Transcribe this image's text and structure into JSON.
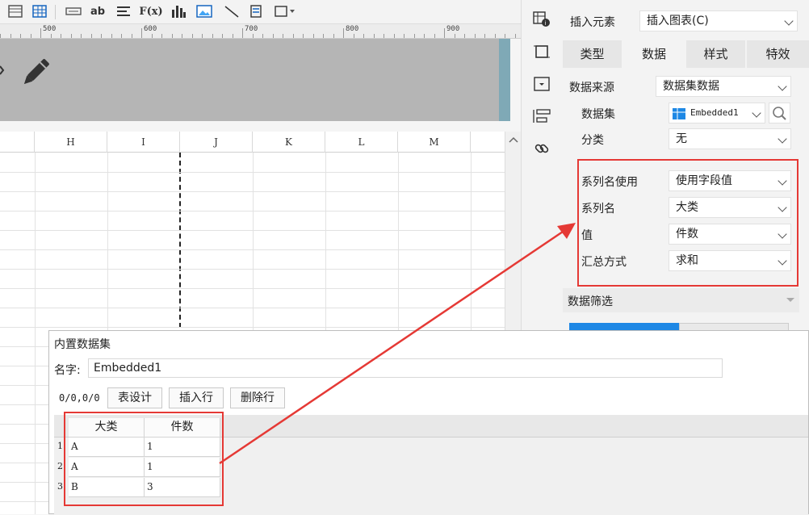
{
  "ruler": {
    "labels": [
      "500",
      "600",
      "700",
      "800",
      "900"
    ]
  },
  "toolbar": {
    "text_icon": "ab",
    "formula_icon": "F(x)"
  },
  "sheet": {
    "columns": [
      "H",
      "I",
      "J",
      "K",
      "L",
      "M"
    ]
  },
  "panel": {
    "insert_label": "插入元素",
    "insert_value": "插入图表(C)",
    "tabs": [
      "类型",
      "数据",
      "样式",
      "特效"
    ],
    "active_tab": "数据",
    "data_source_label": "数据来源",
    "data_source_value": "数据集数据",
    "dataset_label": "数据集",
    "dataset_value": "Embedded1",
    "category_label": "分类",
    "category_value": "无",
    "series_name_use_label": "系列名使用",
    "series_name_use_value": "使用字段值",
    "series_name_label": "系列名",
    "series_name_value": "大类",
    "value_label": "值",
    "value_value": "件数",
    "summary_label": "汇总方式",
    "summary_value": "求和",
    "filter_label": "数据筛选"
  },
  "dialog": {
    "title": "内置数据集",
    "name_label": "名字:",
    "name_value": "Embedded1",
    "position": "0/0,0/0",
    "btn_design": "表设计",
    "btn_insert": "插入行",
    "btn_delete": "删除行",
    "table": {
      "headers": [
        "大类",
        "件数"
      ],
      "rows": [
        {
          "num": "1",
          "cat": "A",
          "count": "1"
        },
        {
          "num": "2",
          "cat": "A",
          "count": "1"
        },
        {
          "num": "3",
          "cat": "B",
          "count": "3"
        }
      ]
    }
  },
  "colors": {
    "accent_red": "#e53935",
    "accent_blue": "#1e88e5"
  }
}
